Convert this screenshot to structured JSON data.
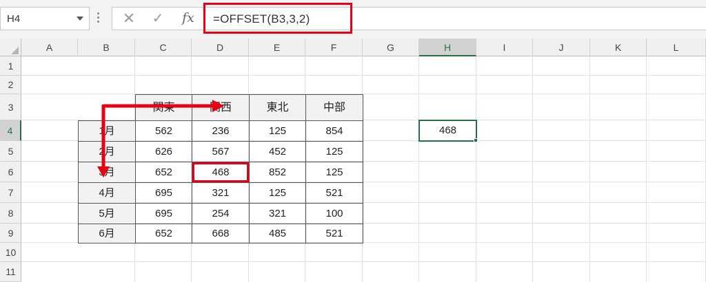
{
  "formula_bar": {
    "name_box": "H4",
    "cancel_icon": "close-icon",
    "enter_icon": "check-icon",
    "fx_label": "fx",
    "formula": "=OFFSET(B3,3,2)"
  },
  "grid": {
    "columns": [
      "A",
      "B",
      "C",
      "D",
      "E",
      "F",
      "G",
      "H",
      "I",
      "J",
      "K",
      "L"
    ],
    "rows": [
      "1",
      "2",
      "3",
      "4",
      "5",
      "6",
      "7",
      "8",
      "9",
      "10",
      "11"
    ],
    "selected_column": "H",
    "selected_row": "4"
  },
  "table": {
    "headers": [
      "関東",
      "関西",
      "東北",
      "中部"
    ],
    "months": [
      "1月",
      "2月",
      "3月",
      "4月",
      "5月",
      "6月"
    ],
    "values": [
      [
        "562",
        "236",
        "125",
        "854"
      ],
      [
        "626",
        "567",
        "452",
        "125"
      ],
      [
        "652",
        "468",
        "852",
        "125"
      ],
      [
        "695",
        "321",
        "125",
        "521"
      ],
      [
        "695",
        "254",
        "321",
        "100"
      ],
      [
        "652",
        "668",
        "485",
        "521"
      ]
    ]
  },
  "result_cell": {
    "value": "468"
  },
  "colors": {
    "highlight": "#e60012",
    "selection": "#217346",
    "header_fill": "#f2f2f2"
  }
}
